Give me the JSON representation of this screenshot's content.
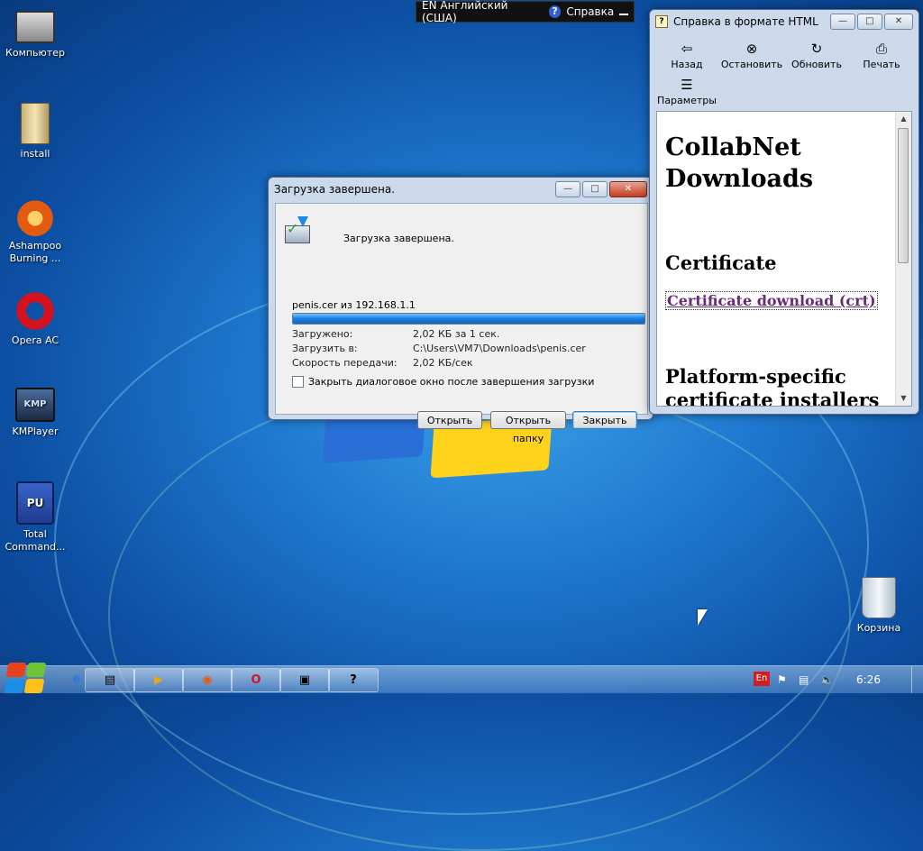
{
  "desktop": {
    "icons": [
      {
        "label": "Компьютер"
      },
      {
        "label": "install"
      },
      {
        "label": "Ashampoo Burning ..."
      },
      {
        "label": "Opera AC"
      },
      {
        "label": "KMPlayer"
      },
      {
        "label": "Total Command..."
      },
      {
        "label": "Корзина"
      }
    ]
  },
  "language_bar": {
    "lang": "EN Английский (США)",
    "help_glyph": "?",
    "help": "Справка"
  },
  "download_dialog": {
    "title": "Загрузка завершена.",
    "message": "Загрузка завершена.",
    "file_line": "penis.cer из 192.168.1.1",
    "progress": 1.0,
    "rows": [
      {
        "key": "Загружено:",
        "value": "2,02 КБ за 1 сек."
      },
      {
        "key": "Загрузить в:",
        "value": "C:\\Users\\VM7\\Downloads\\penis.cer"
      },
      {
        "key": "Скорость передачи:",
        "value": "2,02 КБ/сек"
      }
    ],
    "checkbox_label": "Закрыть диалоговое окно после завершения загрузки",
    "checkbox_checked": false,
    "buttons": {
      "open": "Открыть",
      "open_folder": "Открыть папку",
      "close": "Закрыть"
    }
  },
  "help_window": {
    "title": "Справка в формате HTML",
    "toolbar": {
      "back": "Назад",
      "stop": "Остановить",
      "refresh": "Обновить",
      "print": "Печать",
      "options": "Параметры"
    },
    "content": {
      "title": "CollabNet Downloads",
      "certificate": "Certificate",
      "link": "Certificate download (crt)",
      "platform": "Platform-specific certificate installers"
    }
  },
  "taskbar": {
    "lang_indicator": "En",
    "clock": "6:26",
    "colors": {
      "accent": "#1e7be0",
      "link": "#6a2a7a"
    }
  }
}
